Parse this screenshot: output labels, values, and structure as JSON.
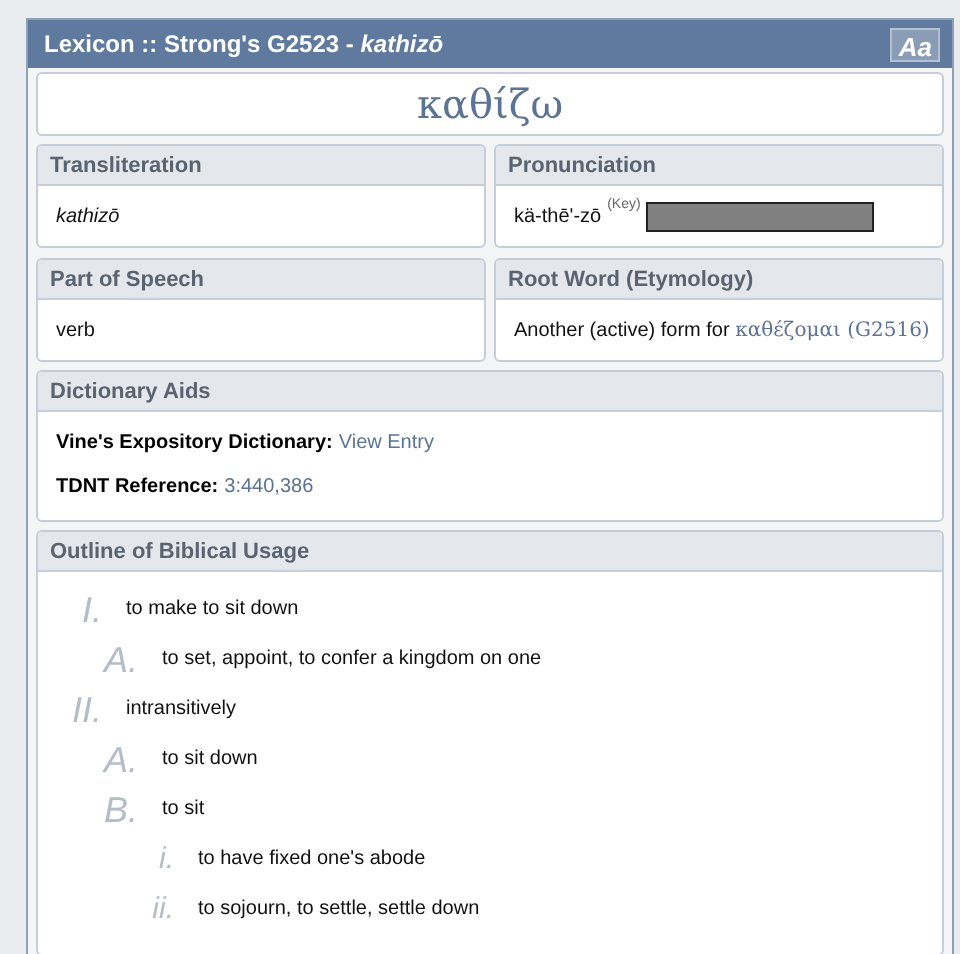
{
  "window": {
    "title": "Lexicon :: Strong's G2523 - ",
    "title_word": "kathizō",
    "font_button": "Aa"
  },
  "headword": "καθίζω",
  "cards": [
    {
      "kind": "italic",
      "title": "Transliteration",
      "text": "kathizō"
    },
    {
      "kind": "pronunciation",
      "title": "Pronunciation",
      "text": "kä-thē'-zō",
      "key": "(Key)"
    },
    {
      "kind": "plain",
      "title": "Part of Speech",
      "text": "verb"
    },
    {
      "kind": "root",
      "title": "Root Word (Etymology)",
      "text": "Another (active) form for ",
      "link": "καθέζομαι (G2516)"
    }
  ],
  "dictionary_aids": {
    "title": "Dictionary Aids",
    "entries": [
      {
        "label": "Vine's Expository Dictionary:",
        "value": "View Entry"
      },
      {
        "label": "TDNT Reference:",
        "value": "3:440,386"
      }
    ]
  },
  "outline": {
    "title": "Outline of Biblical Usage",
    "items": [
      {
        "marker": "I.",
        "text": "to make to sit down",
        "children": [
          {
            "marker": "A.",
            "text": "to set, appoint, to confer a kingdom on one"
          }
        ]
      },
      {
        "marker": "II.",
        "text": "intransitively",
        "children": [
          {
            "marker": "A.",
            "text": "to sit down"
          },
          {
            "marker": "B.",
            "text": "to sit",
            "children": [
              {
                "marker": "i.",
                "text": "to have fixed one's abode"
              },
              {
                "marker": "ii.",
                "text": "to sojourn, to settle, settle down"
              }
            ]
          }
        ]
      }
    ]
  }
}
